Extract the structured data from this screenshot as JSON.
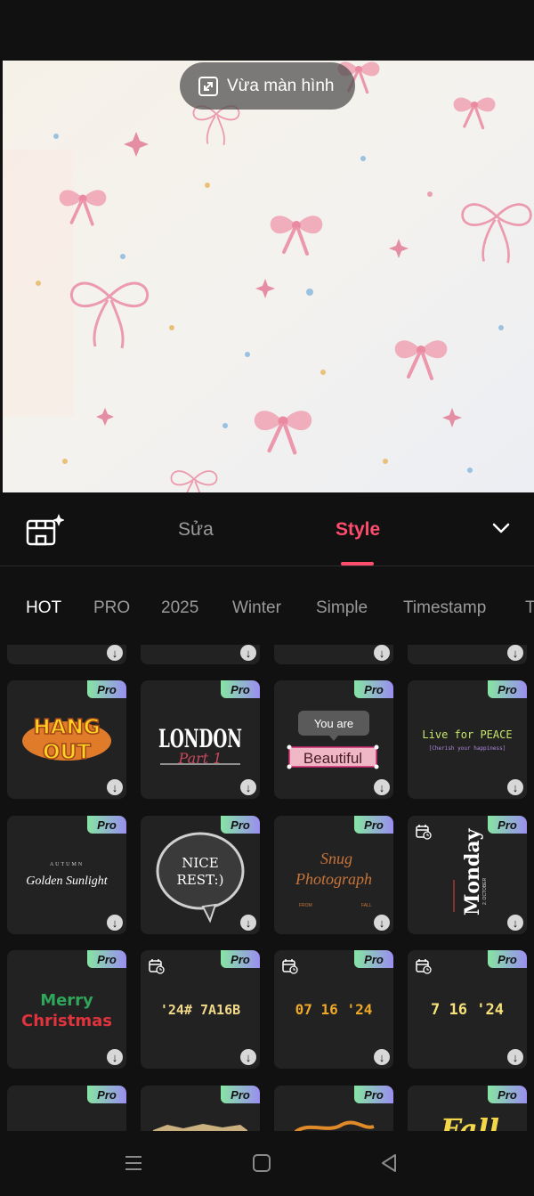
{
  "preview": {
    "fit_label": "Vừa màn hình"
  },
  "tabs": {
    "edit": "Sửa",
    "style": "Style"
  },
  "categories": [
    "HOT",
    "PRO",
    "2025",
    "Winter",
    "Simple",
    "Timestamp",
    "T"
  ],
  "badge": "Pro",
  "templates": {
    "you_are": "You are",
    "beautiful": "Beautiful",
    "hang_out": "HANG OUT",
    "london": "LONDON",
    "part": "Part 1",
    "live_for_peace": "Live for PEACE",
    "cherish": "[Cherish your happiness]",
    "autumn": "AUTUMN",
    "golden_sunlight": "Golden Sunlight",
    "nice_rest": [
      "NICE",
      "REST:)"
    ],
    "snug": "Snug",
    "photograph": "Photograph",
    "from": "FROM",
    "fall_small": "FALL",
    "monday": "Monday",
    "october": "2. OCTOBER",
    "merry": "Merry",
    "christmas": "Christmas",
    "ts1": "'24# 7A16B",
    "ts2": "07 16 '24",
    "ts3": "7 16 '24",
    "fall": "Fall"
  },
  "colors": {
    "accent": "#ff4d6d",
    "background": "#111111",
    "card": "#222222"
  }
}
